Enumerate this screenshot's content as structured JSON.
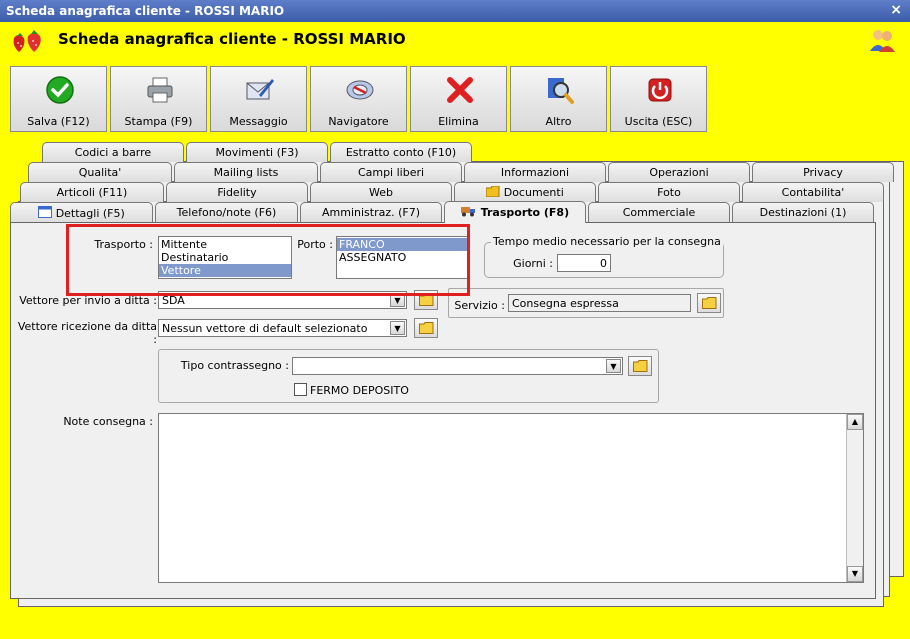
{
  "window": {
    "title": "Scheda anagrafica cliente - ROSSI MARIO",
    "close_glyph": "×"
  },
  "header": {
    "title": "Scheda anagrafica cliente - ROSSI MARIO",
    "logo_icon": "strawberries-icon",
    "users_icon": "users-icon"
  },
  "toolbar": {
    "buttons": [
      {
        "label": "Salva (F12)",
        "icon": "check-icon",
        "color": "#22aa22"
      },
      {
        "label": "Stampa (F9)",
        "icon": "printer-icon"
      },
      {
        "label": "Messaggio",
        "icon": "envelope-pen-icon"
      },
      {
        "label": "Navigatore",
        "icon": "compass-icon"
      },
      {
        "label": "Elimina",
        "icon": "red-x-icon",
        "color": "#e02020"
      },
      {
        "label": "Altro",
        "icon": "magnifier-icon"
      },
      {
        "label": "Uscita (ESC)",
        "icon": "power-icon",
        "color": "#d42020"
      }
    ]
  },
  "tabs": {
    "row1": [
      "Codici a barre",
      "Movimenti (F3)",
      "Estratto conto (F10)"
    ],
    "row2": [
      "Qualita'",
      "Mailing lists",
      "Campi liberi",
      "Informazioni",
      "Operazioni",
      "Privacy"
    ],
    "row3": [
      "Articoli (F11)",
      "Fidelity",
      "Web",
      "Documenti",
      "Foto",
      "Contabilita'"
    ],
    "row4": [
      "Dettagli (F5)",
      "Telefono/note (F6)",
      "Amministraz. (F7)",
      "Trasporto (F8)",
      "Commerciale",
      "Destinazioni (1)"
    ],
    "active": "Trasporto (F8)"
  },
  "form": {
    "trasporto": {
      "label": "Trasporto :",
      "options": [
        "Mittente",
        "Destinatario",
        "Vettore"
      ],
      "selected": "Vettore"
    },
    "porto": {
      "label": "Porto :",
      "options": [
        "FRANCO",
        "ASSEGNATO"
      ],
      "selected": "FRANCO"
    },
    "tempo": {
      "group_label": "Tempo medio necessario per la consegna",
      "giorni_label": "Giorni :",
      "giorni_value": "0"
    },
    "vettore_invio": {
      "label": "Vettore per invio a ditta :",
      "value": "SDA"
    },
    "servizio": {
      "label": "Servizio :",
      "value": "Consegna espressa"
    },
    "vettore_ricezione": {
      "label": "Vettore ricezione da ditta :",
      "value": "Nessun vettore di default selezionato"
    },
    "contrassegno": {
      "label": "Tipo contrassegno :",
      "value": ""
    },
    "fermo_deposito": {
      "label": "FERMO DEPOSITO",
      "checked": false
    },
    "note": {
      "label": "Note consegna :",
      "value": ""
    }
  },
  "colors": {
    "background": "#ffff00",
    "titlebar": "#3b5ca8",
    "selection": "#7f99cc",
    "highlight": "#e02020"
  }
}
